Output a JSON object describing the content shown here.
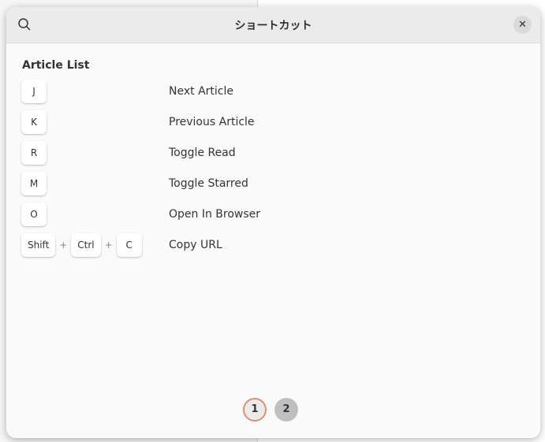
{
  "dialog": {
    "title": "ショートカット",
    "search_icon": "search-icon",
    "close_icon": "close-icon"
  },
  "section": {
    "title": "Article List"
  },
  "shortcuts": [
    {
      "keys": [
        "J"
      ],
      "label": "Next Article"
    },
    {
      "keys": [
        "K"
      ],
      "label": "Previous Article"
    },
    {
      "keys": [
        "R"
      ],
      "label": "Toggle Read"
    },
    {
      "keys": [
        "M"
      ],
      "label": "Toggle Starred"
    },
    {
      "keys": [
        "O"
      ],
      "label": "Open In Browser"
    },
    {
      "keys": [
        "Shift",
        "Ctrl",
        "C"
      ],
      "label": "Copy URL"
    }
  ],
  "plus": "+",
  "pager": {
    "pages": [
      "1",
      "2"
    ],
    "current": "1"
  },
  "colors": {
    "current_page_ring": "#e09070"
  }
}
